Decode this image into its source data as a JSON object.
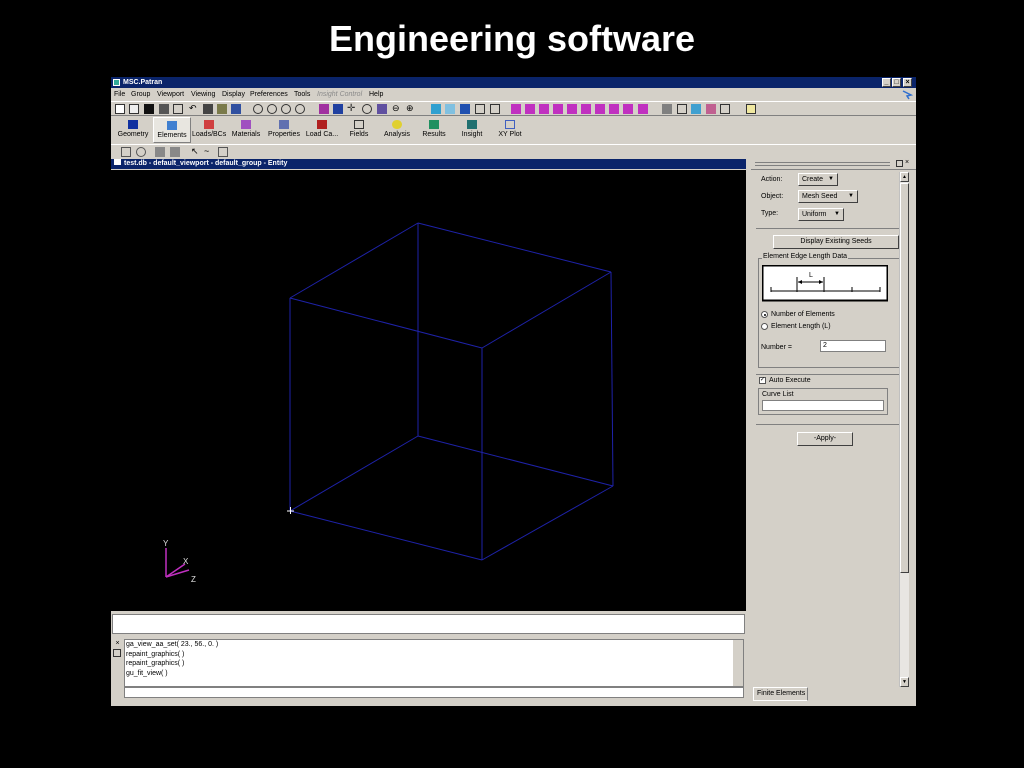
{
  "slide": {
    "title": "Engineering software"
  },
  "app": {
    "title": "MSC.Patran",
    "menus": [
      "File",
      "Group",
      "Viewport",
      "Viewing",
      "Display",
      "Preferences",
      "Tools",
      "Insight Control",
      "Help"
    ],
    "tabs": [
      "Geometry",
      "Elements",
      "Loads/BCs",
      "Materials",
      "Properties",
      "Load Ca...",
      "Fields",
      "Analysis",
      "Results",
      "Insight",
      "XY Plot"
    ],
    "viewport_title": "test.db - default_viewport - default_group - Entity",
    "axes": {
      "y": "Y",
      "x": "X",
      "z": "Z"
    },
    "history": [
      "ga_view_aa_set( 23., 56., 0. )",
      "repaint_graphics( )",
      "repaint_graphics( )",
      "gu_fit_view( )"
    ],
    "status_tab": "Finite Elements"
  },
  "panel": {
    "action_label": "Action:",
    "action_value": "Create",
    "object_label": "Object:",
    "object_value": "Mesh Seed",
    "type_label": "Type:",
    "type_value": "Uniform",
    "display_seeds_button": "Display Existing Seeds",
    "edge_group_label": "Element Edge Length Data",
    "edge_diagram_label": "L",
    "radio_number": "Number of Elements",
    "radio_length": "Element Length (L)",
    "number_label": "Number =",
    "number_value": "2",
    "auto_execute": "Auto Execute",
    "curve_list_label": "Curve List",
    "apply_button": "-Apply-"
  },
  "colors": {
    "title_bar": "#0a246a",
    "wireframe": "#1e22a8",
    "face": "#d4d0c8"
  }
}
